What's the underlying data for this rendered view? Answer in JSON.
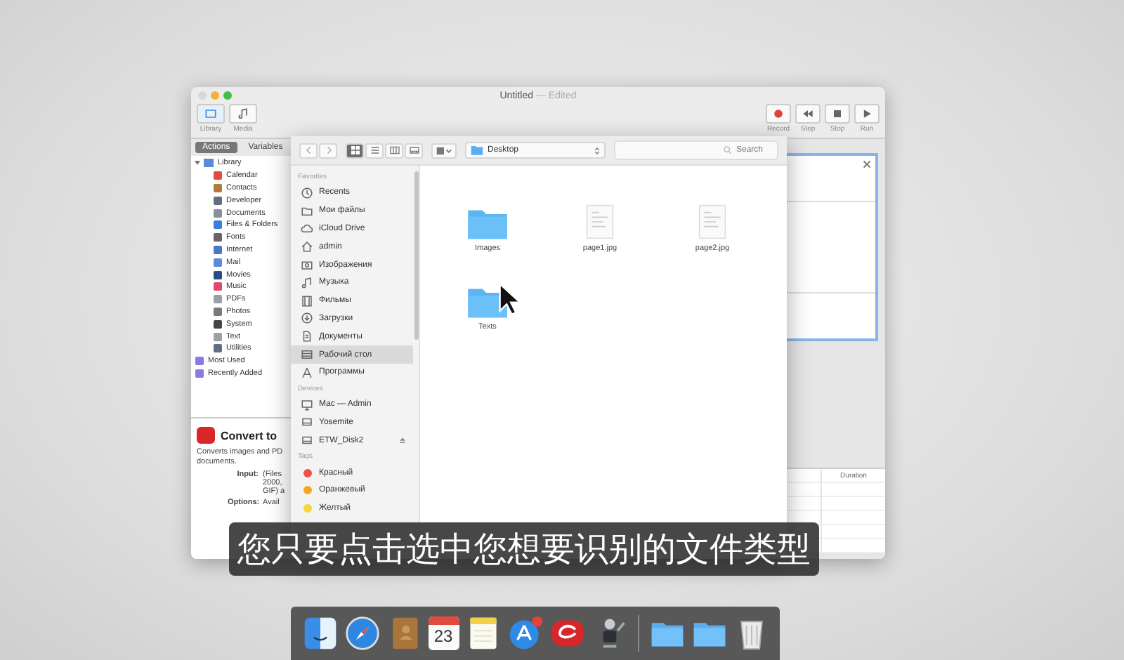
{
  "automator": {
    "title": "Untitled",
    "title_suffix": "— Edited",
    "toolbar_left": [
      {
        "label": "Library",
        "kind": "library",
        "selected": true
      },
      {
        "label": "Media",
        "kind": "media",
        "selected": false
      }
    ],
    "toolbar_right": [
      {
        "label": "Record",
        "kind": "record"
      },
      {
        "label": "Step",
        "kind": "step"
      },
      {
        "label": "Stop",
        "kind": "stop"
      },
      {
        "label": "Run",
        "kind": "run"
      }
    ],
    "tabs": [
      {
        "label": "Actions",
        "selected": true
      },
      {
        "label": "Variables",
        "selected": false
      }
    ],
    "library": {
      "label": "Library",
      "expanded": true,
      "children": [
        {
          "label": "Calendar",
          "color": "#e04a3f"
        },
        {
          "label": "Contacts",
          "color": "#b07a3a"
        },
        {
          "label": "Developer",
          "color": "#607080"
        },
        {
          "label": "Documents",
          "color": "#8a8f99"
        },
        {
          "label": "Files & Folders",
          "color": "#3b7fd8"
        },
        {
          "label": "Fonts",
          "color": "#666666"
        },
        {
          "label": "Internet",
          "color": "#4a78c8"
        },
        {
          "label": "Mail",
          "color": "#5a8ad8"
        },
        {
          "label": "Movies",
          "color": "#2a4a8a"
        },
        {
          "label": "Music",
          "color": "#e04a6a"
        },
        {
          "label": "PDFs",
          "color": "#9aa0aa"
        },
        {
          "label": "Photos",
          "color": "#7a7a7a"
        },
        {
          "label": "System",
          "color": "#444444"
        },
        {
          "label": "Text",
          "color": "#a0a0a0"
        },
        {
          "label": "Utilities",
          "color": "#607080"
        }
      ]
    },
    "smart_groups": [
      "Most Used",
      "Recently Added"
    ],
    "description": {
      "title": "Convert to",
      "lines": [
        "Converts images and PD",
        "documents."
      ],
      "fields": [
        {
          "label": "Input:",
          "value": [
            "(Files",
            "2000,",
            "GIF) a"
          ]
        },
        {
          "label": "Options:",
          "value": [
            "Avail"
          ]
        }
      ]
    },
    "log_header": "Duration"
  },
  "dialog": {
    "views": [
      {
        "kind": "icons",
        "selected": true
      },
      {
        "kind": "list",
        "selected": false
      },
      {
        "kind": "columns",
        "selected": false
      },
      {
        "kind": "coverflow",
        "selected": false
      }
    ],
    "path": "Desktop",
    "search": {
      "placeholder": "Search"
    },
    "sections": [
      {
        "title": "Favorites",
        "items": [
          {
            "label": "Recents",
            "kind": "recents",
            "selected": false
          },
          {
            "label": "Мои файлы",
            "kind": "files",
            "selected": false
          },
          {
            "label": "iCloud Drive",
            "kind": "cloud",
            "selected": false
          },
          {
            "label": "admin",
            "kind": "home",
            "selected": false
          },
          {
            "label": "Изображения",
            "kind": "pictures",
            "selected": false
          },
          {
            "label": "Музыка",
            "kind": "music",
            "selected": false
          },
          {
            "label": "Фильмы",
            "kind": "movies",
            "selected": false
          },
          {
            "label": "Загрузки",
            "kind": "downloads",
            "selected": false
          },
          {
            "label": "Документы",
            "kind": "documents",
            "selected": false
          },
          {
            "label": "Рабочий стол",
            "kind": "desktop",
            "selected": true
          },
          {
            "label": "Программы",
            "kind": "apps",
            "selected": false
          }
        ]
      },
      {
        "title": "Devices",
        "items": [
          {
            "label": "Mac — Admin",
            "kind": "computer",
            "selected": false
          },
          {
            "label": "Yosemite",
            "kind": "disk",
            "selected": false
          },
          {
            "label": "ETW_Disk2",
            "kind": "disk",
            "selected": false,
            "eject": true
          }
        ]
      },
      {
        "title": "Tags",
        "items": [
          {
            "label": "Красный",
            "kind": "tag",
            "color": "#f0524a",
            "selected": false
          },
          {
            "label": "Оранжевый",
            "kind": "tag",
            "color": "#f5a623",
            "selected": false
          },
          {
            "label": "Желтый",
            "kind": "tag",
            "color": "#f7d43a",
            "selected": false
          }
        ]
      }
    ],
    "files": [
      {
        "name": "Images",
        "kind": "folder"
      },
      {
        "name": "page1.jpg",
        "kind": "image"
      },
      {
        "name": "page2.jpg",
        "kind": "image"
      },
      {
        "name": "Texts",
        "kind": "folder"
      }
    ]
  },
  "caption": "您只要点击选中您想要识别的文件类型",
  "dock": [
    {
      "kind": "finder"
    },
    {
      "kind": "safari"
    },
    {
      "kind": "contacts"
    },
    {
      "kind": "calendar",
      "date": "23"
    },
    {
      "kind": "notes"
    },
    {
      "kind": "appstore",
      "badge": true
    },
    {
      "kind": "swirl"
    },
    {
      "kind": "robot"
    },
    {
      "kind": "separator"
    },
    {
      "kind": "folder"
    },
    {
      "kind": "folder"
    },
    {
      "kind": "trash"
    }
  ]
}
